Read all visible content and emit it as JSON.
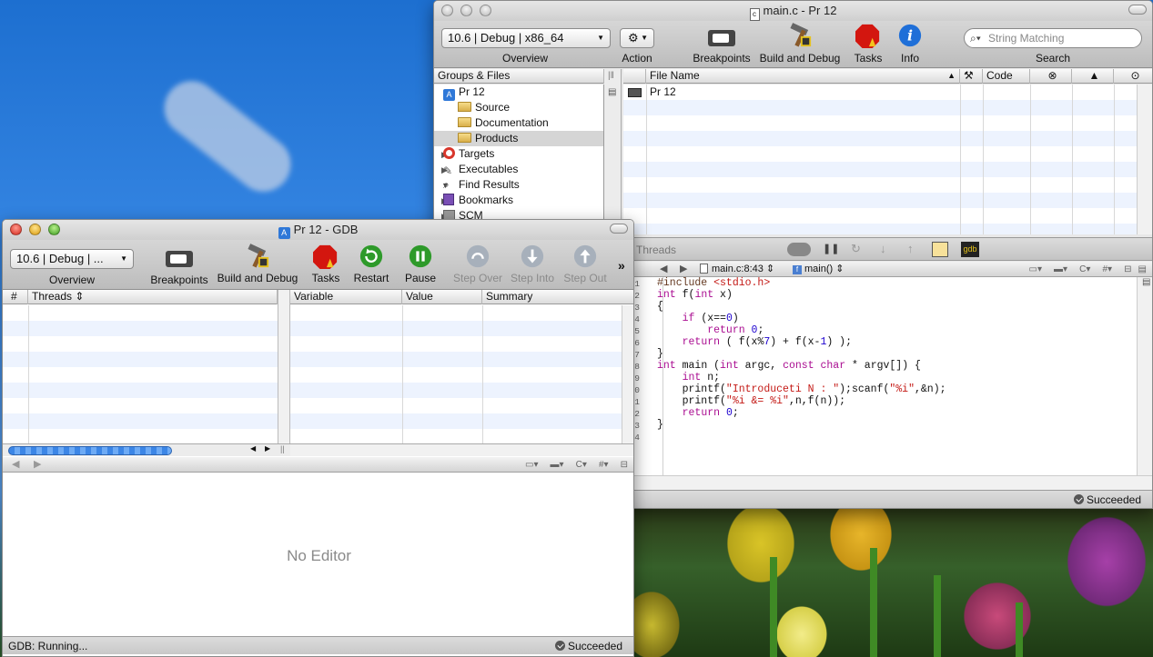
{
  "main_window": {
    "title": "main.c - Pr 12",
    "file_icon_letter": "c",
    "toolbar": {
      "overview_popup": "10.6 | Debug | x86_64",
      "overview_label": "Overview",
      "action_label": "Action",
      "breakpoints_label": "Breakpoints",
      "build_debug_label": "Build and Debug",
      "tasks_label": "Tasks",
      "info_label": "Info",
      "search_placeholder": "String Matching",
      "search_label": "Search"
    },
    "groups_header": "Groups & Files",
    "tree": [
      {
        "label": "Pr 12",
        "expanded": true,
        "indent": 0,
        "icon": "project-icon"
      },
      {
        "label": "Source",
        "expanded": false,
        "indent": 1,
        "icon": "folder-icon"
      },
      {
        "label": "Documentation",
        "expanded": false,
        "indent": 1,
        "icon": "folder-icon"
      },
      {
        "label": "Products",
        "expanded": false,
        "indent": 1,
        "icon": "folder-icon",
        "selected": true
      },
      {
        "label": "Targets",
        "expanded": false,
        "indent": 0,
        "icon": "target-icon"
      },
      {
        "label": "Executables",
        "expanded": false,
        "indent": 0,
        "icon": "executable-icon"
      },
      {
        "label": "Find Results",
        "expanded": false,
        "indent": 0,
        "icon": "magnifier-icon"
      },
      {
        "label": "Bookmarks",
        "expanded": false,
        "indent": 0,
        "icon": "book-icon"
      },
      {
        "label": "SCM",
        "expanded": false,
        "indent": 0,
        "icon": "scm-icon"
      }
    ],
    "files_table": {
      "col_file_name": "File Name",
      "col_code": "Code",
      "rows": [
        {
          "name": "Pr 12"
        }
      ]
    },
    "debug_strip": {
      "threads_label": "Threads"
    },
    "nav_bar": {
      "file": "main.c:8:43",
      "function": "main()"
    },
    "code_lines": [
      "#include <stdio.h>",
      "int f(int x)",
      "{",
      "    if (x==0)",
      "        return 0;",
      "    return ( f(x%7) + f(x-1) );",
      "}",
      "int main (int argc, const char * argv[]) {",
      "    int n;",
      "    printf(\"Introduceti N : \");scanf(\"%i\",&n);",
      "    printf(\"%i &= %i\",n,f(n));",
      "    return 0;",
      "}",
      ""
    ],
    "status": "Succeeded"
  },
  "gdb_window": {
    "title": "Pr 12 - GDB",
    "toolbar": {
      "overview_popup": "10.6 | Debug | ...",
      "overview_label": "Overview",
      "breakpoints_label": "Breakpoints",
      "build_debug_label": "Build and Debug",
      "tasks_label": "Tasks",
      "restart_label": "Restart",
      "pause_label": "Pause",
      "step_over_label": "Step Over",
      "step_into_label": "Step Into",
      "step_out_label": "Step Out"
    },
    "threads_table": {
      "col_num": "#",
      "col_threads": "Threads"
    },
    "vars_table": {
      "col_variable": "Variable",
      "col_value": "Value",
      "col_summary": "Summary"
    },
    "editor_placeholder": "No Editor",
    "status_left": "GDB: Running...",
    "status_right": "Succeeded"
  }
}
